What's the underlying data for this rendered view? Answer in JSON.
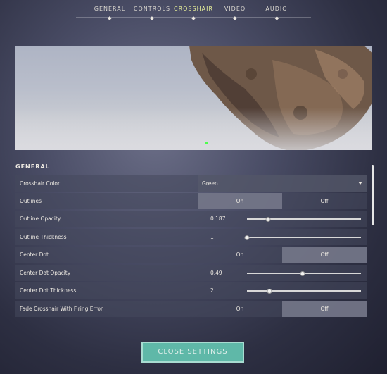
{
  "nav": {
    "tabs": [
      {
        "label": "GENERAL"
      },
      {
        "label": "CONTROLS"
      },
      {
        "label": "CROSSHAIR"
      },
      {
        "label": "VIDEO"
      },
      {
        "label": "AUDIO"
      }
    ],
    "active": "CROSSHAIR"
  },
  "section": {
    "title": "GENERAL"
  },
  "settings": {
    "crosshair_color": {
      "label": "Crosshair Color",
      "value": "Green"
    },
    "outlines": {
      "label": "Outlines",
      "on": "On",
      "off": "Off",
      "selected": "on"
    },
    "outline_opacity": {
      "label": "Outline Opacity",
      "value": "0.187",
      "fraction": 0.187
    },
    "outline_thickness": {
      "label": "Outline Thickness",
      "value": "1",
      "fraction": 0.0
    },
    "center_dot": {
      "label": "Center Dot",
      "on": "On",
      "off": "Off",
      "selected": "off"
    },
    "center_dot_opacity": {
      "label": "Center Dot Opacity",
      "value": "0.49",
      "fraction": 0.49
    },
    "center_dot_thickness": {
      "label": "Center Dot Thickness",
      "value": "2",
      "fraction": 0.2
    },
    "fade_crosshair": {
      "label": "Fade Crosshair With Firing Error",
      "on": "On",
      "off": "Off",
      "selected": "off"
    }
  },
  "close_button": {
    "label": "CLOSE SETTINGS"
  },
  "colors": {
    "accent": "#e8f09a",
    "button": "#5fb8a8",
    "crosshair": "#4cff4c"
  }
}
